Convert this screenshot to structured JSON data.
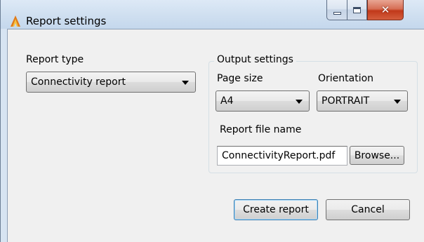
{
  "window": {
    "title": "Report settings",
    "icon": "app-logo-icon",
    "controls": {
      "minimize": "minimize-icon",
      "maximize": "maximize-icon",
      "close": "close-icon"
    }
  },
  "report_type": {
    "label": "Report type",
    "selected": "Connectivity report"
  },
  "output_settings": {
    "legend": "Output settings",
    "page_size": {
      "label": "Page size",
      "selected": "A4"
    },
    "orientation": {
      "label": "Orientation",
      "selected": "PORTRAIT"
    },
    "file_name": {
      "label": "Report file name",
      "value": "ConnectivityReport.pdf"
    },
    "browse_label": "Browse..."
  },
  "actions": {
    "create_label": "Create report",
    "cancel_label": "Cancel"
  },
  "colors": {
    "client_background": "#f0f0f0",
    "title_bar": "#cfdff0",
    "close_button": "#c1391a",
    "default_button_border": "#3c7fb1"
  }
}
